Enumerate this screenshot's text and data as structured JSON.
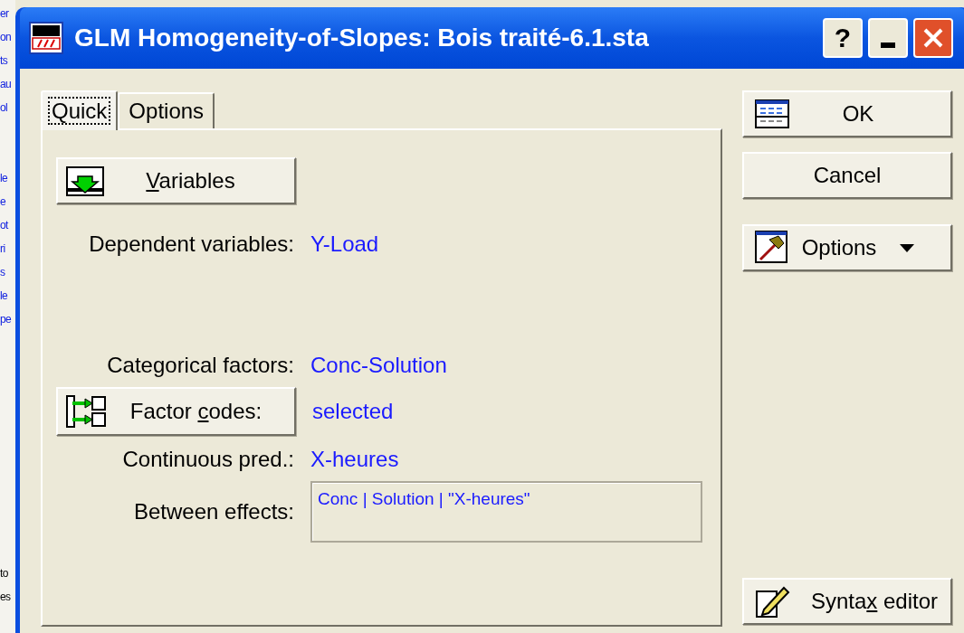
{
  "background": {
    "fragments": [
      "er",
      "on",
      "ts",
      "au",
      "ol",
      "le",
      "e",
      "ot",
      "ri",
      "s",
      "le",
      "pe",
      "to",
      "es"
    ]
  },
  "window": {
    "title": "GLM Homogeneity-of-Slopes: Bois traité-6.1.sta",
    "controls": [
      {
        "kind": "help",
        "label": "?"
      },
      {
        "kind": "minimize"
      },
      {
        "kind": "close"
      }
    ]
  },
  "tabs": [
    {
      "label": "Quick",
      "selected": true,
      "focused": true
    },
    {
      "label": "Options",
      "selected": false,
      "focused": false
    }
  ],
  "variables_button": {
    "key": "V",
    "after": "ariables"
  },
  "fields": [
    {
      "kind": "value",
      "label": "Dependent variables:",
      "value": "Y-Load"
    },
    {
      "kind": "value",
      "label": "Categorical factors:",
      "value": "Conc-Solution"
    },
    {
      "kind": "button",
      "before": "Factor ",
      "key": "c",
      "after": "odes:",
      "value": "selected"
    },
    {
      "kind": "value",
      "label": "Continuous pred.:",
      "value": "X-heures"
    },
    {
      "kind": "box",
      "label": "Between effects:",
      "value": "Conc | Solution | \"X-heures\""
    }
  ],
  "buttons": [
    {
      "kind": "ok",
      "before": "OK"
    },
    {
      "kind": "cancel",
      "before": "Cancel"
    },
    {
      "kind": "menu",
      "before": "Options"
    },
    {
      "kind": "syntax",
      "before": "Synta",
      "key": "x",
      "after": " editor"
    }
  ]
}
